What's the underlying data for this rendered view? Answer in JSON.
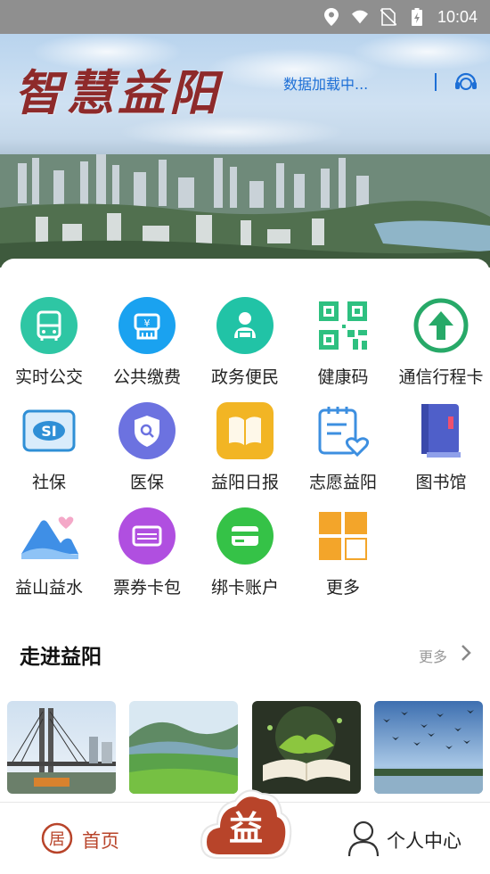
{
  "status_bar": {
    "time": "10:04",
    "icons": [
      "location-icon",
      "wifi-icon",
      "no-sim-icon",
      "battery-charging-icon"
    ]
  },
  "banner": {
    "logo_text": "智慧益阳",
    "loading_text": "数据加载中...",
    "service_icon": "customer-service-icon"
  },
  "services": [
    {
      "label": "实时公交",
      "icon": "bus-icon",
      "color": "#2ec6a4"
    },
    {
      "label": "公共缴费",
      "icon": "payment-icon",
      "color": "#1aa2f0"
    },
    {
      "label": "政务便民",
      "icon": "government-service-icon",
      "color": "#21c3a6"
    },
    {
      "label": "健康码",
      "icon": "qr-code-icon",
      "color": "#2ec080"
    },
    {
      "label": "通信行程卡",
      "icon": "arrow-up-circle-icon",
      "color": "#27a968"
    },
    {
      "label": "社保",
      "icon": "social-security-icon",
      "color": "#2f8fd6"
    },
    {
      "label": "医保",
      "icon": "medical-insurance-icon",
      "color": "#6c72e0"
    },
    {
      "label": "益阳日报",
      "icon": "newspaper-icon",
      "color": "#f2b524"
    },
    {
      "label": "志愿益阳",
      "icon": "volunteer-icon",
      "color": "#3d8fe0"
    },
    {
      "label": "图书馆",
      "icon": "library-book-icon",
      "color": "#4f5fc9"
    },
    {
      "label": "益山益水",
      "icon": "mountain-water-icon",
      "color": "#3f8fe6"
    },
    {
      "label": "票券卡包",
      "icon": "ticket-card-icon",
      "color": "#b04fe0"
    },
    {
      "label": "绑卡账户",
      "icon": "bank-card-icon",
      "color": "#35c247"
    },
    {
      "label": "更多",
      "icon": "more-grid-icon",
      "color": "#f3a52a"
    }
  ],
  "section": {
    "title": "走进益阳",
    "more_label": "更多"
  },
  "thumbnails": [
    {
      "name": "bridge-photo"
    },
    {
      "name": "lake-mountain-photo"
    },
    {
      "name": "open-book-photo"
    },
    {
      "name": "birds-wetland-photo"
    }
  ],
  "bottom_nav": {
    "home_label": "首页",
    "center_label": "益",
    "profile_label": "个人中心",
    "accent": "#b8442a"
  }
}
